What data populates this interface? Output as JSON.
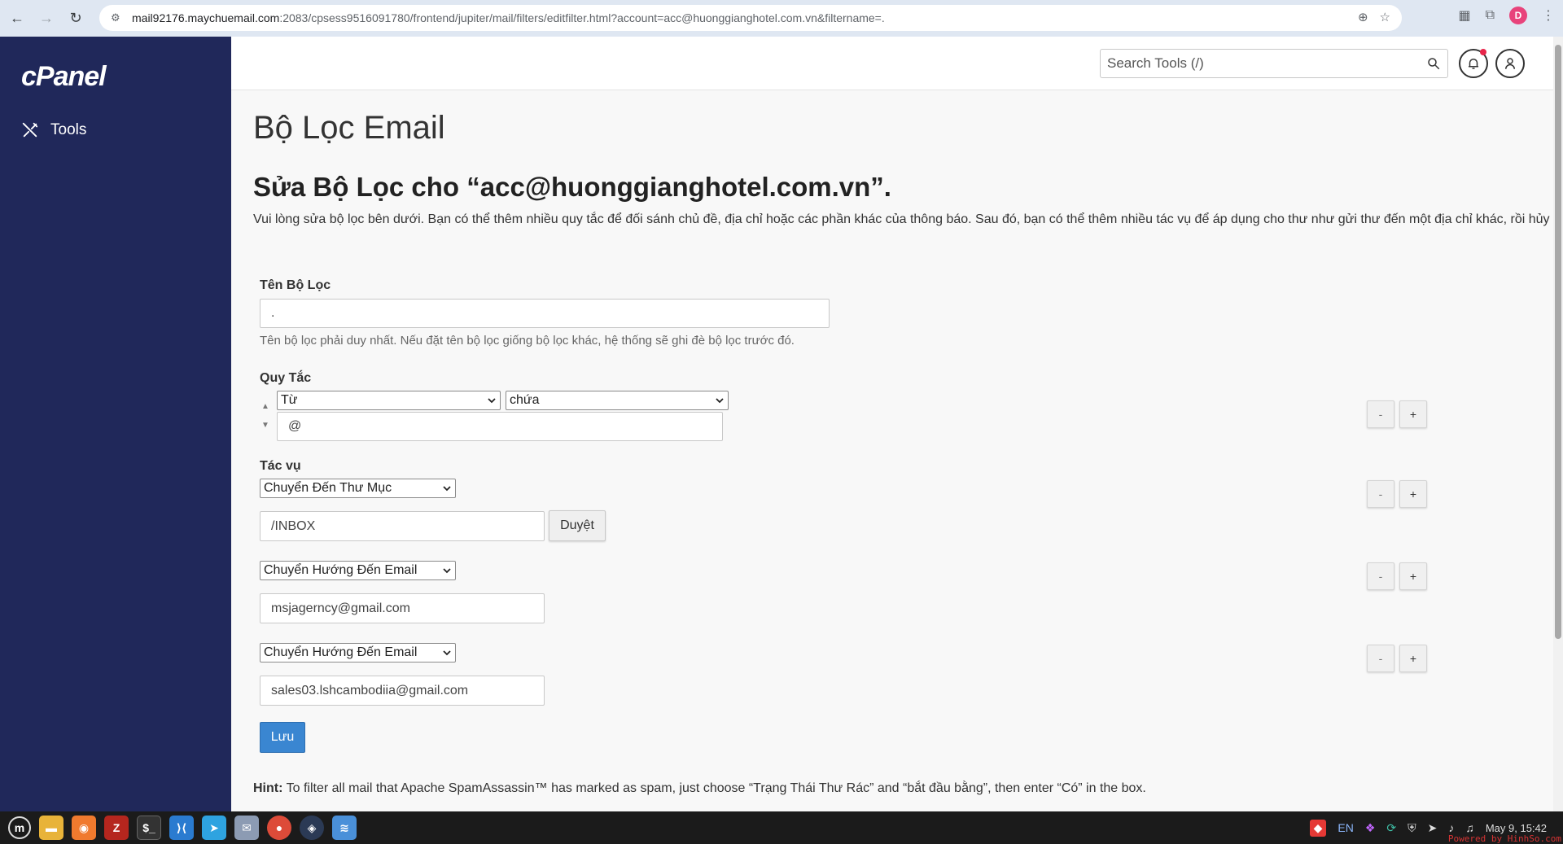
{
  "browser": {
    "url_host": "mail92176.maychuemail.com",
    "url_path": ":2083/cpsess9516091780/frontend/jupiter/mail/filters/editfilter.html?account=acc@huonggianghotel.com.vn&filtername=.",
    "profile_initial": "D"
  },
  "sidebar": {
    "logo": "cPanel",
    "items": [
      {
        "label": "Tools",
        "icon": "tools-icon"
      }
    ]
  },
  "header": {
    "search_placeholder": "Search Tools (/)"
  },
  "page": {
    "title": "Bộ Lọc Email",
    "subtitle": "Sửa Bộ Lọc cho “acc@huonggianghotel.com.vn”.",
    "description": "Vui lòng sửa bộ lọc bên dưới. Bạn có thể thêm nhiều quy tắc để đối sánh chủ đề, địa chỉ hoặc các phần khác của thông báo. Sau đó, bạn có thể thêm nhiều tác vụ để áp dụng cho thư như gửi thư đến một địa chỉ khác, rồi hủy bỏ thư."
  },
  "filter_name": {
    "label": "Tên Bộ Lọc",
    "value": ".",
    "help": "Tên bộ lọc phải duy nhất. Nếu đặt tên bộ lọc giống bộ lọc khác, hệ thống sẽ ghi đè bộ lọc trước đó."
  },
  "rules": {
    "label": "Quy Tắc",
    "items": [
      {
        "field": "Từ",
        "operator": "chứa",
        "value": "@"
      }
    ]
  },
  "actions": {
    "label": "Tác vụ",
    "items": [
      {
        "action": "Chuyển Đến Thư Mục",
        "value": "/INBOX",
        "browse_label": "Duyệt"
      },
      {
        "action": "Chuyển Hướng Đến Email",
        "value": "msjagerncy@gmail.com"
      },
      {
        "action": "Chuyển Hướng Đến Email",
        "value": "sales03.lshcambodiia@gmail.com"
      }
    ]
  },
  "buttons": {
    "minus": "-",
    "plus": "+",
    "save": "Lưu"
  },
  "hint": {
    "prefix": "Hint:",
    "text": "To filter all mail that Apache SpamAssassin™ has marked as spam, just choose “Trạng Thái Thư Rác” and “bắt đầu bằng”, then enter “Có” in the box."
  },
  "taskbar": {
    "lang": "EN",
    "clock": "May  9, 15:42",
    "watermark": "Powered by HinhSo.com"
  },
  "colors": {
    "sidebar": "#20285a",
    "primary_button": "#3a86d1"
  }
}
